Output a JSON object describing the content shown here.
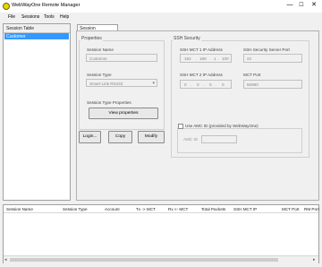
{
  "window": {
    "title": "WebWayOne Remote Manager",
    "controls": {
      "minimize": "—",
      "maximize": "☐",
      "close": "✕"
    }
  },
  "menu": [
    "File",
    "Sessions",
    "Tools",
    "Help"
  ],
  "session_table": {
    "header": "Session Table",
    "items": [
      "Customer"
    ]
  },
  "tabs": [
    "Session Configuration"
  ],
  "properties": {
    "group_label": "Properties",
    "session_name_label": "Session Name",
    "session_name_value": "Customer",
    "session_type_label": "Session Type",
    "session_type_value": "Smart Link RS232",
    "session_type_props_label": "Session Type Properties",
    "view_properties_button": "View properties"
  },
  "ssh_security": {
    "group_label": "SSH Security",
    "mct1_label": "SSH MCT 1 IP Address",
    "mct1_octets": [
      "192",
      "168",
      "1",
      "100"
    ],
    "mct2_label": "SSH MCT 2 IP Address",
    "mct2_octets": [
      "0",
      "0",
      "0",
      "0"
    ],
    "server_port_label": "SSH Security Server Port",
    "server_port_value": "22",
    "mct_port_label": "MCT Port",
    "mct_port_value": "50960"
  },
  "amc": {
    "checkbox_label": "Use AMC ID (provided by WebWayOne)",
    "checked": false,
    "amc_id_label": "AMC ID",
    "amc_id_value": ""
  },
  "buttons": {
    "login": "Login...",
    "copy": "Copy",
    "modify": "Modify"
  },
  "bottom_table": {
    "columns": [
      "Session Name",
      "Session Type",
      "Account",
      "Tx -> MCT",
      "Rx <- MCT",
      "Total Packets",
      "SSH MCT IP",
      "MCT Port",
      "RM Port"
    ]
  }
}
